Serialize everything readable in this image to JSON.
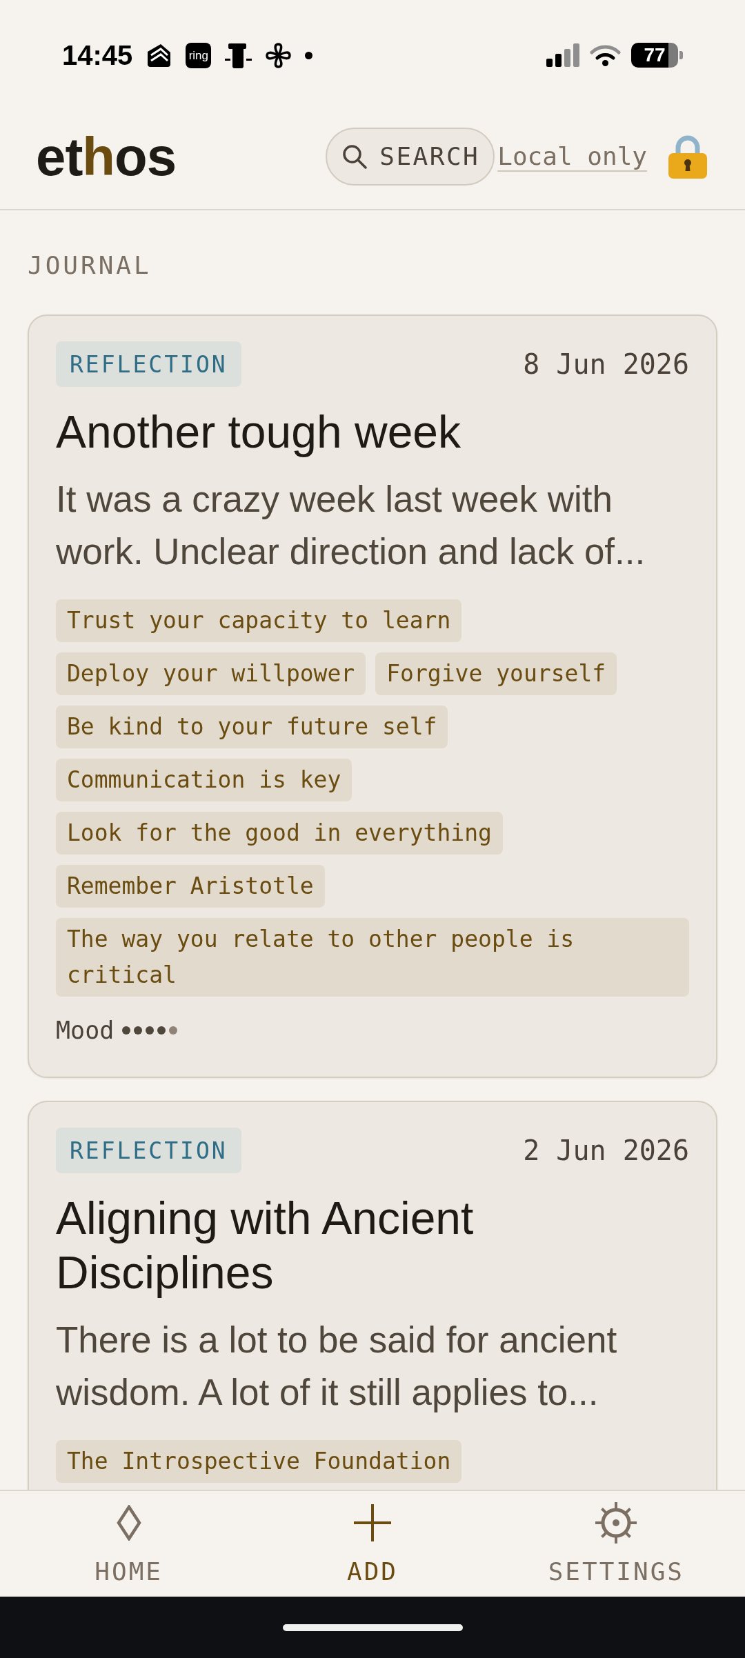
{
  "status_bar": {
    "time": "14:45",
    "app_badge": "ring",
    "battery": "77"
  },
  "header": {
    "logo": [
      {
        "text": "et",
        "accent": false
      },
      {
        "text": "h",
        "accent": true
      },
      {
        "text": "os",
        "accent": false
      }
    ],
    "search_button": "SEARCH",
    "storage_link": "Local only"
  },
  "section_title": "JOURNAL",
  "entries": [
    {
      "category": "REFLECTION",
      "date": "8 Jun 2026",
      "title": "Another tough week",
      "excerpt": "It was a crazy week last week with work. Unclear direction and lack of...",
      "tags": [
        "Trust your capacity to learn",
        "Deploy your willpower",
        "Forgive yourself",
        "Be kind to your future self",
        "Communication is key",
        "Look for the good in everything",
        "Remember Aristotle",
        "The way you relate to other people is critical"
      ],
      "mood": {
        "label": "Mood",
        "stars": 4
      }
    },
    {
      "category": "REFLECTION",
      "date": "2 Jun 2026",
      "title": "Aligning with Ancient Disciplines",
      "excerpt": "There is a lot to be said for ancient wisdom. A lot of it still applies to...",
      "tags": [
        "The Introspective Foundation"
      ]
    }
  ],
  "nav": [
    {
      "kind": "home",
      "label": "HOME",
      "highlighted": false
    },
    {
      "kind": "add",
      "label": "ADD",
      "highlighted": true
    },
    {
      "kind": "settings",
      "label": "SETTINGS",
      "highlighted": false
    }
  ]
}
